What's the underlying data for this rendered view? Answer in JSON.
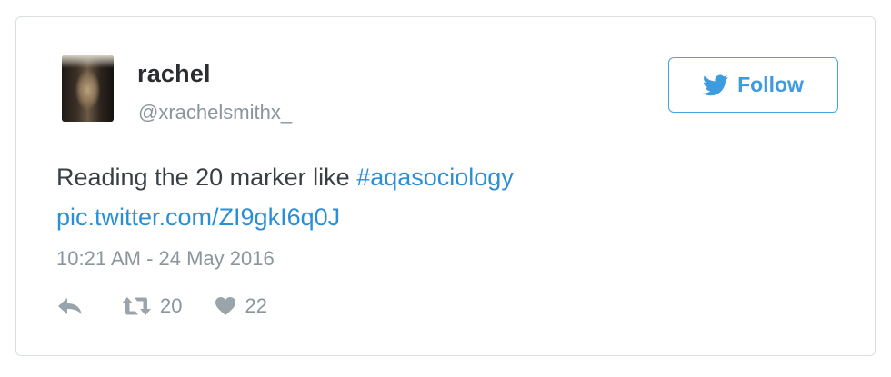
{
  "user": {
    "display_name": "rachel",
    "handle": "@xrachelsmithx_"
  },
  "follow_button": {
    "label": "Follow",
    "icon": "twitter-bird-icon"
  },
  "tweet": {
    "text": "Reading the 20 marker like",
    "hashtag": "#aqasociology",
    "link": "pic.twitter.com/ZI9gkI6q0J",
    "timestamp": "10:21 AM - 24 May 2016"
  },
  "actions": {
    "reply_icon": "reply-icon",
    "retweet_icon": "retweet-icon",
    "retweet_count": "20",
    "like_icon": "heart-icon",
    "like_count": "22"
  },
  "colors": {
    "accent": "#2a8fd6",
    "muted": "#8a959c",
    "border": "#d9dfe3"
  }
}
